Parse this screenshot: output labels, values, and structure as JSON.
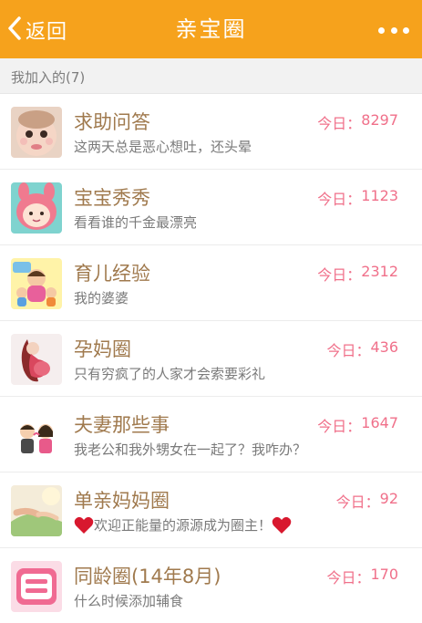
{
  "header": {
    "back_label": "返回",
    "title": "亲宝圈",
    "accent_color": "#f6a21c"
  },
  "section": {
    "label": "我加入的(7)"
  },
  "today_prefix": "今日：",
  "groups": [
    {
      "name": "求助问答",
      "desc": "这两天总是恶心想吐，还头晕",
      "today": "8297",
      "icon": "baby-photo-icon"
    },
    {
      "name": "宝宝秀秀",
      "desc": "看看谁的千金最漂亮",
      "today": "1123",
      "icon": "cartoon-bunny-icon"
    },
    {
      "name": "育儿经验",
      "desc": "我的婆婆",
      "today": "2312",
      "icon": "family-cartoon-icon"
    },
    {
      "name": "孕妈圈",
      "desc": "只有穷疯了的人家才会索要彩礼",
      "today": "436",
      "icon": "pregnant-woman-icon"
    },
    {
      "name": "夫妻那些事",
      "desc": "我老公和我外甥女在一起了？我咋办？",
      "today": "1647",
      "icon": "couple-cartoon-icon"
    },
    {
      "name": "单亲妈妈圈",
      "desc": "欢迎正能量的源源成为圈主！",
      "today": "92",
      "icon": "holding-hands-icon"
    },
    {
      "name": "同龄圈(14年8月)",
      "desc": "什么时候添加辅食",
      "today": "170",
      "icon": "same-age-badge-icon"
    }
  ]
}
